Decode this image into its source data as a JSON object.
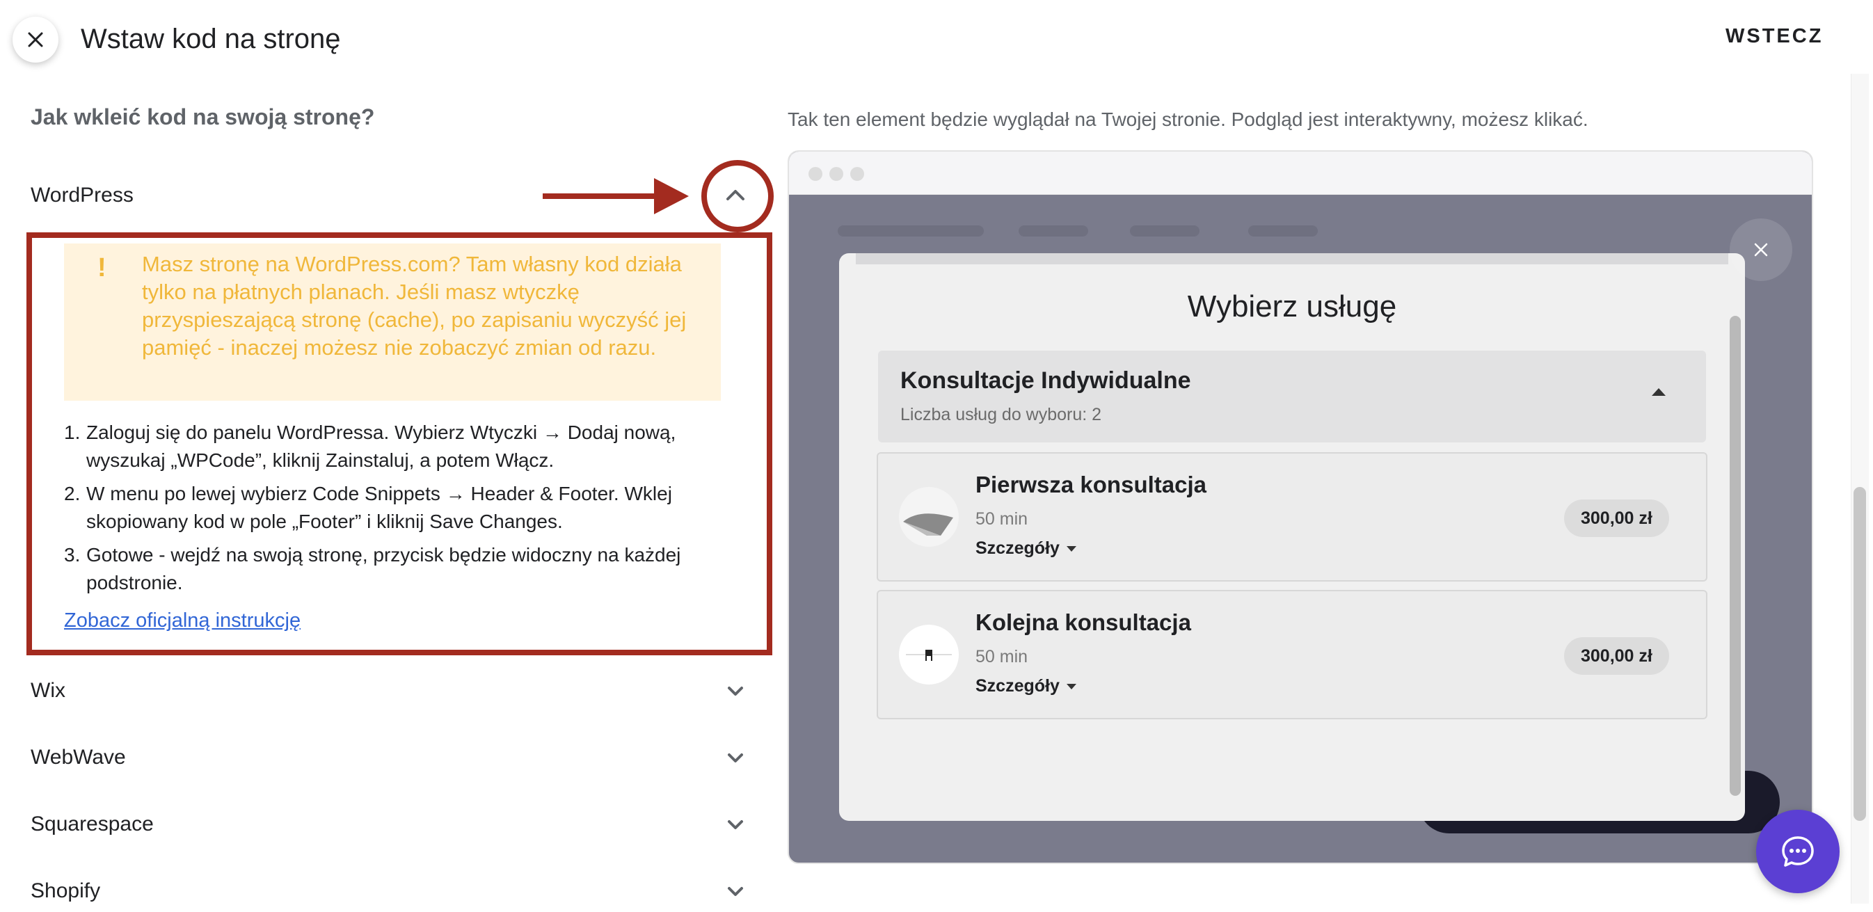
{
  "header": {
    "title": "Wstaw kod na stronę",
    "back_label": "WSTECZ"
  },
  "left": {
    "heading": "Jak wkleić kod na swoją stronę?",
    "platforms": [
      {
        "label": "WordPress",
        "expanded": true
      },
      {
        "label": "Wix",
        "expanded": false
      },
      {
        "label": "WebWave",
        "expanded": false
      },
      {
        "label": "Squarespace",
        "expanded": false
      },
      {
        "label": "Shopify",
        "expanded": false
      }
    ],
    "wordpress": {
      "warning_mark": "!",
      "warning": "Masz stronę na WordPress.com? Tam własny kod działa tylko na płatnych planach. Jeśli masz wtyczkę przyspieszającą stronę (cache), po zapisaniu wyczyść jej pamięć - inaczej możesz nie zobaczyć zmian od razu.",
      "steps": [
        {
          "num": "1.",
          "text": "Zaloguj się do panelu WordPressa. Wybierz Wtyczki → Dodaj nową, wyszukaj „WPCode”, kliknij Zainstaluj, a potem Włącz."
        },
        {
          "num": "2.",
          "text": "W menu po lewej wybierz Code Snippets → Header & Footer. Wklej skopiowany kod w pole „Footer” i kliknij Save Changes."
        },
        {
          "num": "3.",
          "text": "Gotowe - wejdź na swoją stronę, przycisk będzie widoczny na każdej podstronie."
        }
      ],
      "link": "Zobacz oficjalną instrukcję"
    }
  },
  "right": {
    "note": "Tak ten element będzie wyglądał na Twojej stronie. Podgląd jest interaktywny, możesz klikać.",
    "modal": {
      "title": "Wybierz usługę",
      "category": {
        "title": "Konsultacje Indywidualne",
        "subtitle": "Liczba usług do wyboru: 2"
      },
      "services": [
        {
          "name": "Pierwsza konsultacja",
          "duration": "50 min",
          "details": "Szczegóły",
          "price": "300,00 zł"
        },
        {
          "name": "Kolejna konsultacja",
          "duration": "50 min",
          "details": "Szczegóły",
          "price": "300,00 zł"
        }
      ]
    }
  },
  "colors": {
    "annotation_red": "#a32b1f",
    "warning_text": "#f0b73a",
    "warning_bg": "#fff3dd",
    "link": "#3166d6",
    "chat": "#5b3fd3"
  },
  "icons": [
    "close-icon",
    "chevron-up-icon",
    "chevron-down-icon",
    "chat-icon"
  ]
}
